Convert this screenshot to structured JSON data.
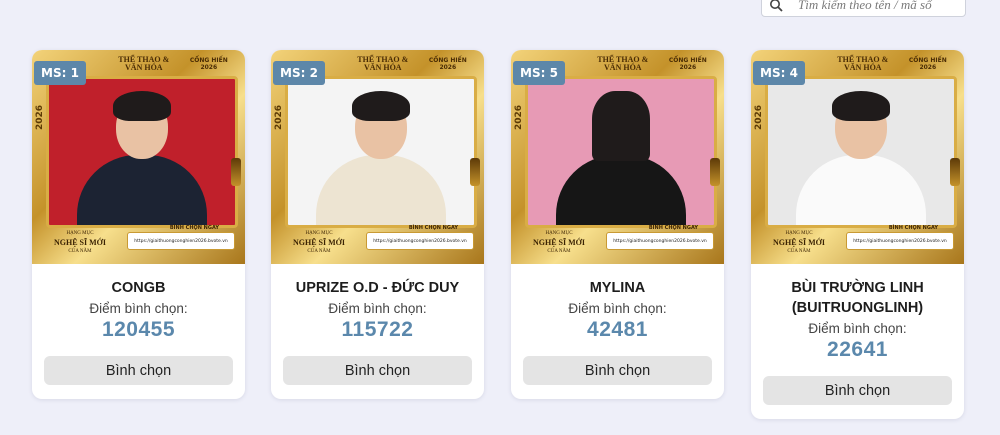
{
  "search": {
    "placeholder": "Tìm kiếm theo tên / mã số"
  },
  "poster_text": {
    "brand": "THỂ THAO & VĂN HÓA",
    "award": "CỐNG HIẾN 2026",
    "year": "2026",
    "category_line1": "NGHỆ SĨ MỚI",
    "category_line2": "CỦA NĂM",
    "category_small": "HẠNG MỤC",
    "cta_label": "BÌNH CHỌN NGAY",
    "cta_url": "https://giaithuongconghien2026.bvote.vn"
  },
  "score_label": "Điểm bình chọn:",
  "vote_label": "Bình chọn",
  "cards": [
    {
      "badge": "MS: 1",
      "name": "CONGB",
      "score": "120455",
      "bg": "#c0202b",
      "outfit": "#1c2333"
    },
    {
      "badge": "MS: 2",
      "name": "UPRIZE O.D - ĐỨC DUY",
      "score": "115722",
      "bg": "#f4f4f4",
      "outfit": "#ede4d2"
    },
    {
      "badge": "MS: 5",
      "name": "MYLINA",
      "score": "42481",
      "bg": "#e79ab5",
      "outfit": "#161616"
    },
    {
      "badge": "MS: 4",
      "name": "BÙI TRƯỜNG LINH (BUITRUONGLINH)",
      "score": "22641",
      "bg": "#e8e8e8",
      "outfit": "#fafafa"
    }
  ]
}
